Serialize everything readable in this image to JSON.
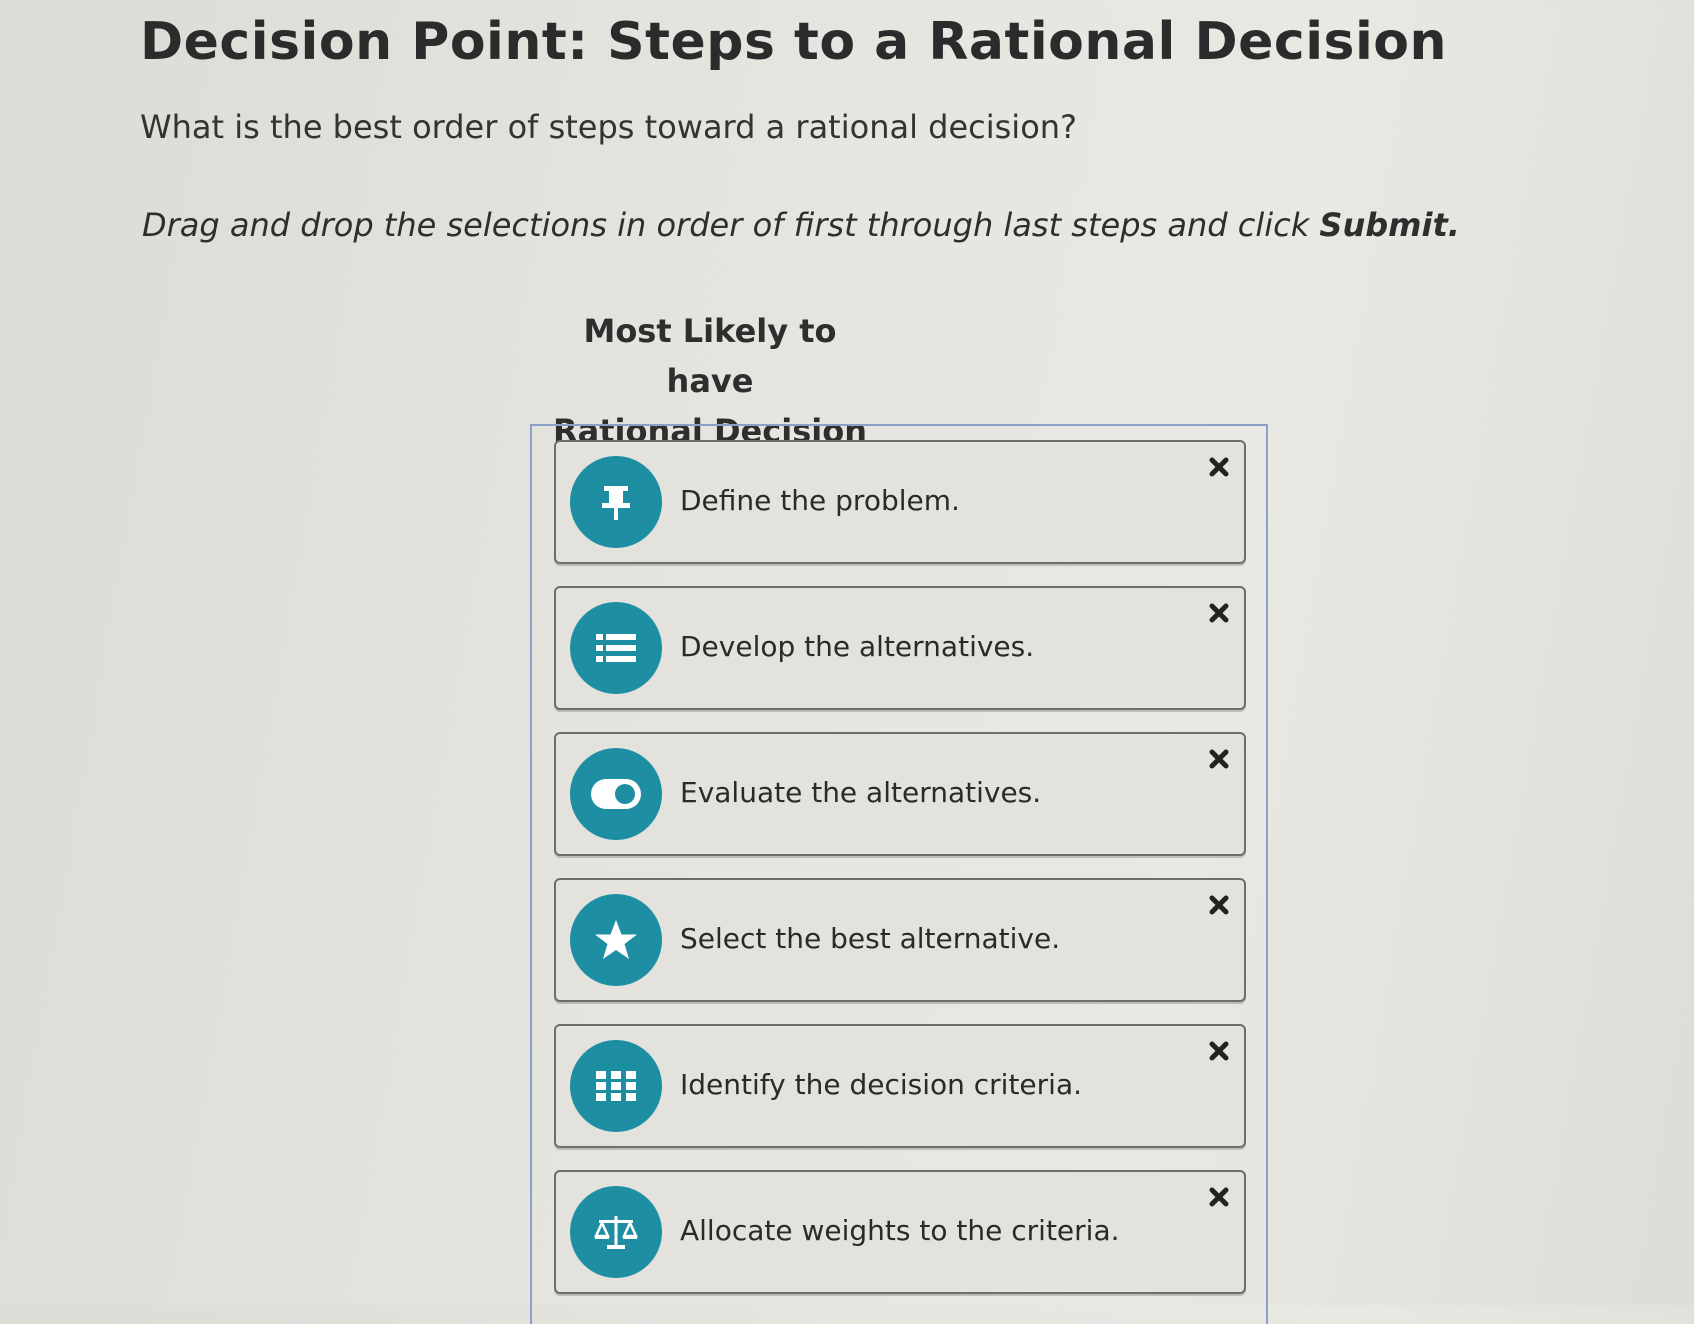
{
  "page": {
    "title": "Decision Point: Steps to a Rational Decision",
    "question": "What is the best order of steps toward a rational decision?",
    "instruction_prefix": "Drag and drop the selections in order of first through last steps and click ",
    "instruction_submit": "Submit."
  },
  "dropzone": {
    "heading_line1": "Most Likely to have",
    "heading_line2": "Rational Decision"
  },
  "items": [
    {
      "label": "Define the problem.",
      "icon": "pin-icon"
    },
    {
      "label": "Develop the alternatives.",
      "icon": "list-icon"
    },
    {
      "label": "Evaluate the alternatives.",
      "icon": "toggle-icon"
    },
    {
      "label": "Select the best alternative.",
      "icon": "star-icon"
    },
    {
      "label": "Identify the decision criteria.",
      "icon": "grid-icon"
    },
    {
      "label": "Allocate weights to the criteria.",
      "icon": "scale-icon"
    }
  ],
  "colors": {
    "icon_bg": "#1e8ea3",
    "card_bg": "#e3e2dd",
    "zone_border": "#8aa0c8"
  }
}
